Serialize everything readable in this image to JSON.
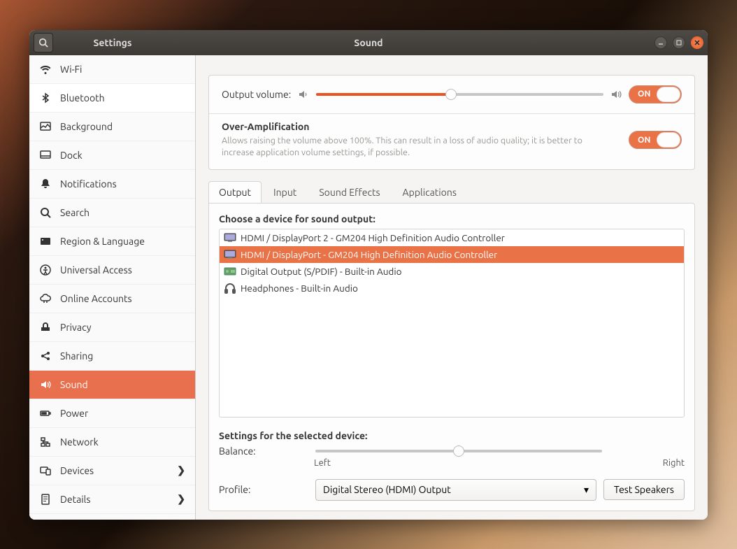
{
  "titlebar": {
    "settings_label": "Settings",
    "window_title": "Sound"
  },
  "sidebar": {
    "items": [
      {
        "label": "Wi-Fi",
        "icon": "wifi"
      },
      {
        "label": "Bluetooth",
        "icon": "bluetooth"
      },
      {
        "label": "Background",
        "icon": "background"
      },
      {
        "label": "Dock",
        "icon": "dock"
      },
      {
        "label": "Notifications",
        "icon": "bell"
      },
      {
        "label": "Search",
        "icon": "search"
      },
      {
        "label": "Region & Language",
        "icon": "region"
      },
      {
        "label": "Universal Access",
        "icon": "access"
      },
      {
        "label": "Online Accounts",
        "icon": "cloud"
      },
      {
        "label": "Privacy",
        "icon": "privacy"
      },
      {
        "label": "Sharing",
        "icon": "share"
      },
      {
        "label": "Sound",
        "icon": "sound"
      },
      {
        "label": "Power",
        "icon": "power"
      },
      {
        "label": "Network",
        "icon": "network"
      },
      {
        "label": "Devices",
        "icon": "devices",
        "chevron": true
      },
      {
        "label": "Details",
        "icon": "details",
        "chevron": true
      }
    ],
    "chevron": "❯",
    "selected_index": 11,
    "hover_index": 1
  },
  "volume": {
    "label": "Output volume:",
    "percent": 47,
    "mute_on": "ON"
  },
  "overamp": {
    "title": "Over-Amplification",
    "description": "Allows raising the volume above 100%. This can result in a loss of audio quality; it is better to increase application volume settings, if possible.",
    "on": "ON"
  },
  "tabs": {
    "items": [
      "Output",
      "Input",
      "Sound Effects",
      "Applications"
    ],
    "active_index": 0
  },
  "output": {
    "choose_label": "Choose a device for sound output:",
    "devices": [
      {
        "label": "HDMI / DisplayPort 2 - GM204 High Definition Audio Controller",
        "icon": "monitor"
      },
      {
        "label": "HDMI / DisplayPort - GM204 High Definition Audio Controller",
        "icon": "monitor"
      },
      {
        "label": "Digital Output (S/PDIF) - Built-in Audio",
        "icon": "card"
      },
      {
        "label": "Headphones - Built-in Audio",
        "icon": "headphones"
      }
    ],
    "selected_index": 1,
    "settings_label": "Settings for the selected device:",
    "balance_label": "Balance:",
    "balance_left": "Left",
    "balance_right": "Right",
    "balance_percent": 50,
    "profile_label": "Profile:",
    "profile_value": "Digital Stereo (HDMI) Output",
    "test_speakers": "Test Speakers"
  }
}
